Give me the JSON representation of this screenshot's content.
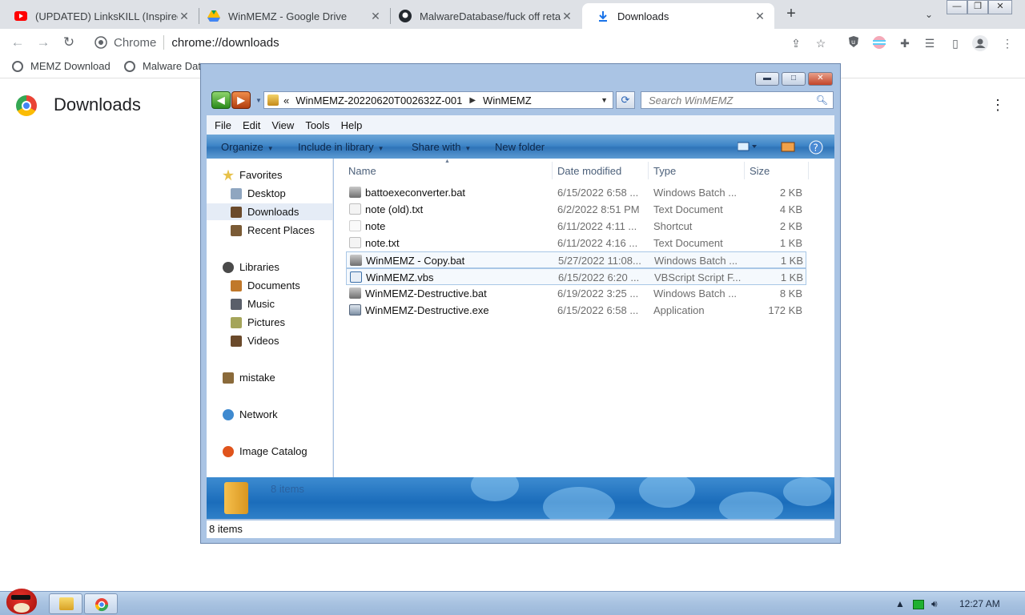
{
  "browser": {
    "tabs": [
      {
        "title": "(UPDATED) LinksKILL (Inspired",
        "icon": "youtube-icon",
        "color": "#ff0000"
      },
      {
        "title": "WinMEMZ - Google Drive",
        "icon": "google-drive-icon",
        "color": "#0f9d58"
      },
      {
        "title": "MalwareDatabase/fuck off reta",
        "icon": "github-icon",
        "color": "#24292f"
      },
      {
        "title": "Downloads",
        "icon": "download-icon",
        "color": "#1a73e8"
      }
    ],
    "omnibox": {
      "site": "Chrome",
      "url": "chrome://downloads"
    },
    "bookmarks": [
      {
        "label": "MEMZ Download"
      },
      {
        "label": "Malware Dat"
      }
    ],
    "page_title": "Downloads"
  },
  "explorer": {
    "breadcrumb": {
      "prefix": "«",
      "parts": [
        "WinMEMZ-20220620T002632Z-001",
        "WinMEMZ"
      ]
    },
    "search_placeholder": "Search WinMEMZ",
    "menu": [
      "File",
      "Edit",
      "View",
      "Tools",
      "Help"
    ],
    "commands": [
      "Organize",
      "Include in library",
      "Share with",
      "New folder"
    ],
    "nav": {
      "favorites": {
        "label": "Favorites",
        "items": [
          "Desktop",
          "Downloads",
          "Recent Places"
        ]
      },
      "libraries": {
        "label": "Libraries",
        "items": [
          "Documents",
          "Music",
          "Pictures",
          "Videos"
        ]
      },
      "homegroup": "mistake",
      "network": "Network",
      "catalog": "Image Catalog"
    },
    "columns": [
      "Name",
      "Date modified",
      "Type",
      "Size"
    ],
    "files": [
      {
        "name": "battoexeconverter.bat",
        "date": "6/15/2022 6:58 ...",
        "type": "Windows Batch ...",
        "size": "2 KB",
        "icon": "batch-file-icon"
      },
      {
        "name": "note (old).txt",
        "date": "6/2/2022 8:51 PM",
        "type": "Text Document",
        "size": "4 KB",
        "icon": "text-file-icon"
      },
      {
        "name": "note",
        "date": "6/11/2022 4:11 ...",
        "type": "Shortcut",
        "size": "2 KB",
        "icon": "shortcut-icon"
      },
      {
        "name": "note.txt",
        "date": "6/11/2022 4:16 ...",
        "type": "Text Document",
        "size": "1 KB",
        "icon": "text-file-icon"
      },
      {
        "name": "WinMEMZ - Copy.bat",
        "date": "5/27/2022 11:08...",
        "type": "Windows Batch ...",
        "size": "1 KB",
        "icon": "batch-file-icon"
      },
      {
        "name": "WinMEMZ.vbs",
        "date": "6/15/2022 6:20 ...",
        "type": "VBScript Script F...",
        "size": "1 KB",
        "icon": "vbscript-file-icon"
      },
      {
        "name": "WinMEMZ-Destructive.bat",
        "date": "6/19/2022 3:25 ...",
        "type": "Windows Batch ...",
        "size": "8 KB",
        "icon": "batch-file-icon"
      },
      {
        "name": "WinMEMZ-Destructive.exe",
        "date": "6/15/2022 6:58 ...",
        "type": "Application",
        "size": "172 KB",
        "icon": "application-icon"
      }
    ],
    "details_count": "8 items",
    "status": "8 items"
  },
  "taskbar": {
    "clock": "12:27 AM"
  }
}
